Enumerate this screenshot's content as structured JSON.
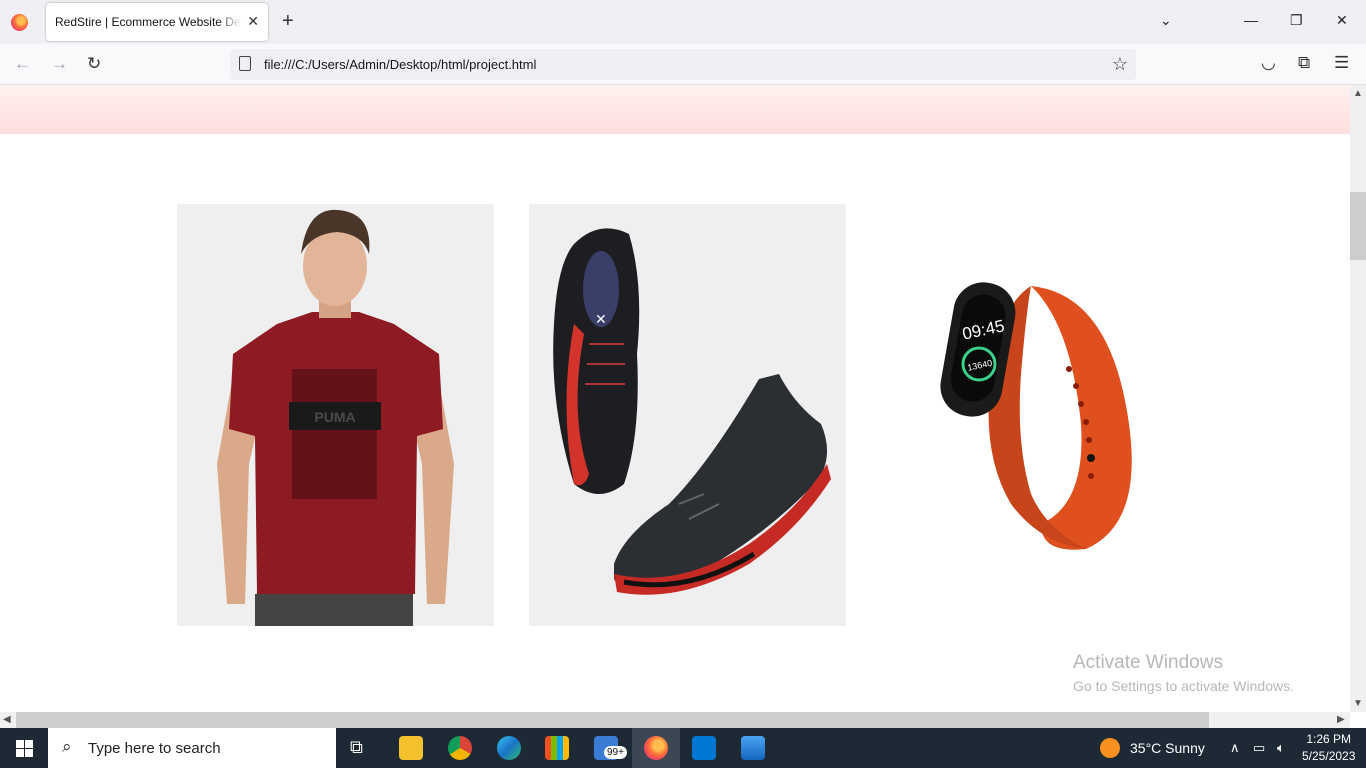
{
  "browser": {
    "tab_title": "RedStire | Ecommerce Website Design",
    "url": "file:///C:/Users/Admin/Desktop/html/project.html",
    "new_tab_label": "+",
    "close_glyph": "✕"
  },
  "page": {
    "band_color": "#ffdede",
    "products": [
      {
        "name": "red-tshirt",
        "alt": "Red printed t-shirt"
      },
      {
        "name": "black-red-sneakers",
        "alt": "Black and red sneakers"
      },
      {
        "name": "orange-smart-band",
        "alt": "Orange smart band"
      }
    ],
    "watch_time": "09:45",
    "watch_steps": "13640"
  },
  "watermark": {
    "title": "Activate Windows",
    "subtitle": "Go to Settings to activate Windows."
  },
  "taskbar": {
    "search_placeholder": "Type here to search",
    "weather": "35°C  Sunny",
    "mail_badge": "99+",
    "time": "1:26 PM",
    "date": "5/25/2023"
  }
}
